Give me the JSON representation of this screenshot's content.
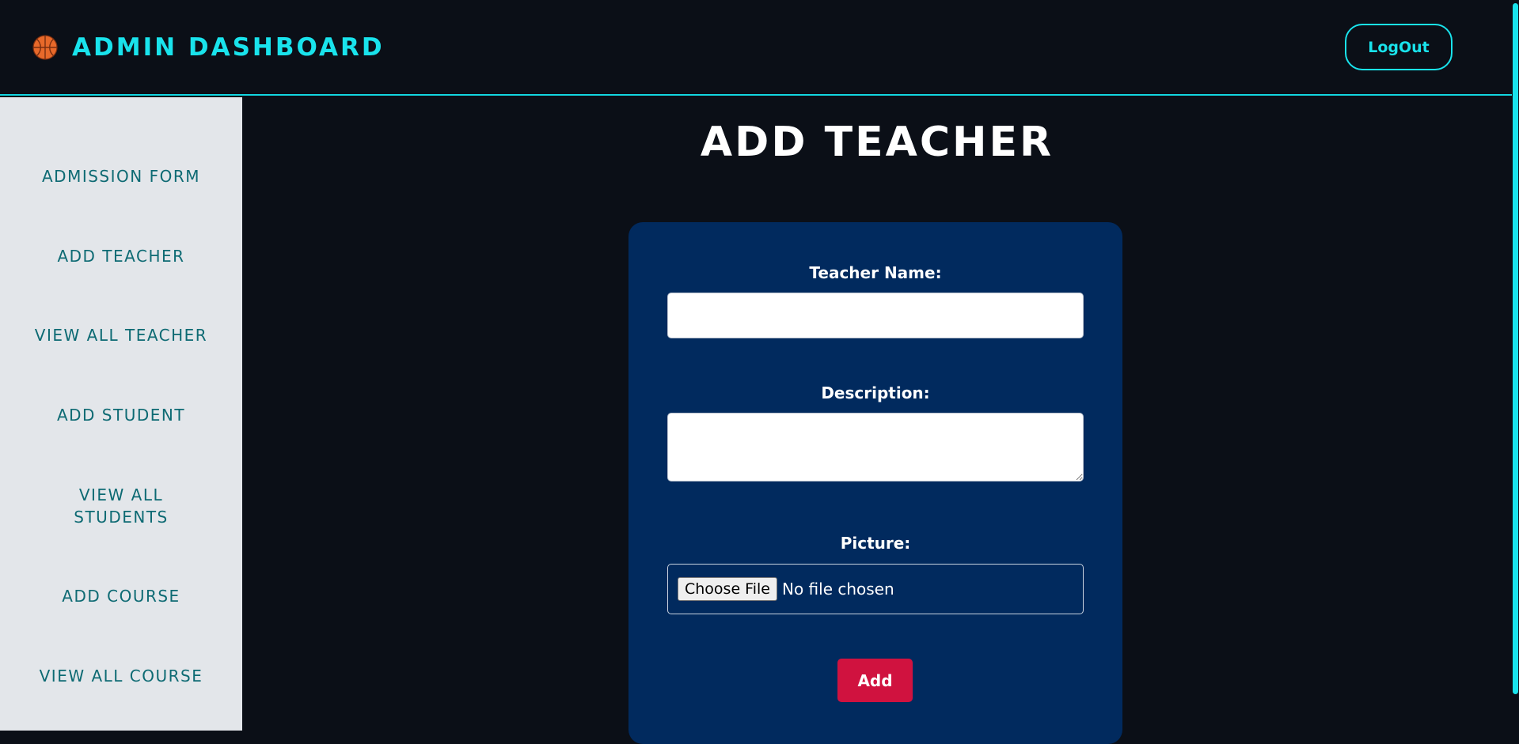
{
  "header": {
    "title": "ADMIN DASHBOARD",
    "logo_icon": "basketball-icon",
    "logout_label": "LogOut"
  },
  "sidebar": {
    "items": [
      {
        "label": "ADMISSION FORM"
      },
      {
        "label": "ADD TEACHER"
      },
      {
        "label": "VIEW ALL TEACHER"
      },
      {
        "label": "ADD STUDENT"
      },
      {
        "label": "VIEW ALL STUDENTS"
      },
      {
        "label": "ADD COURSE"
      },
      {
        "label": "VIEW ALL COURSE"
      }
    ]
  },
  "main": {
    "title": "ADD TEACHER",
    "form": {
      "name_label": "Teacher Name:",
      "name_value": "",
      "description_label": "Description:",
      "description_value": "",
      "picture_label": "Picture:",
      "file_button_label": "Choose File",
      "file_status": "No file chosen",
      "submit_label": "Add"
    }
  },
  "colors": {
    "accent": "#19e3ec",
    "background": "#0b0f17",
    "sidebar_bg": "#e3e6ea",
    "sidebar_text": "#0d6a73",
    "card_bg": "#012a5e",
    "submit_bg": "#d0123f"
  }
}
